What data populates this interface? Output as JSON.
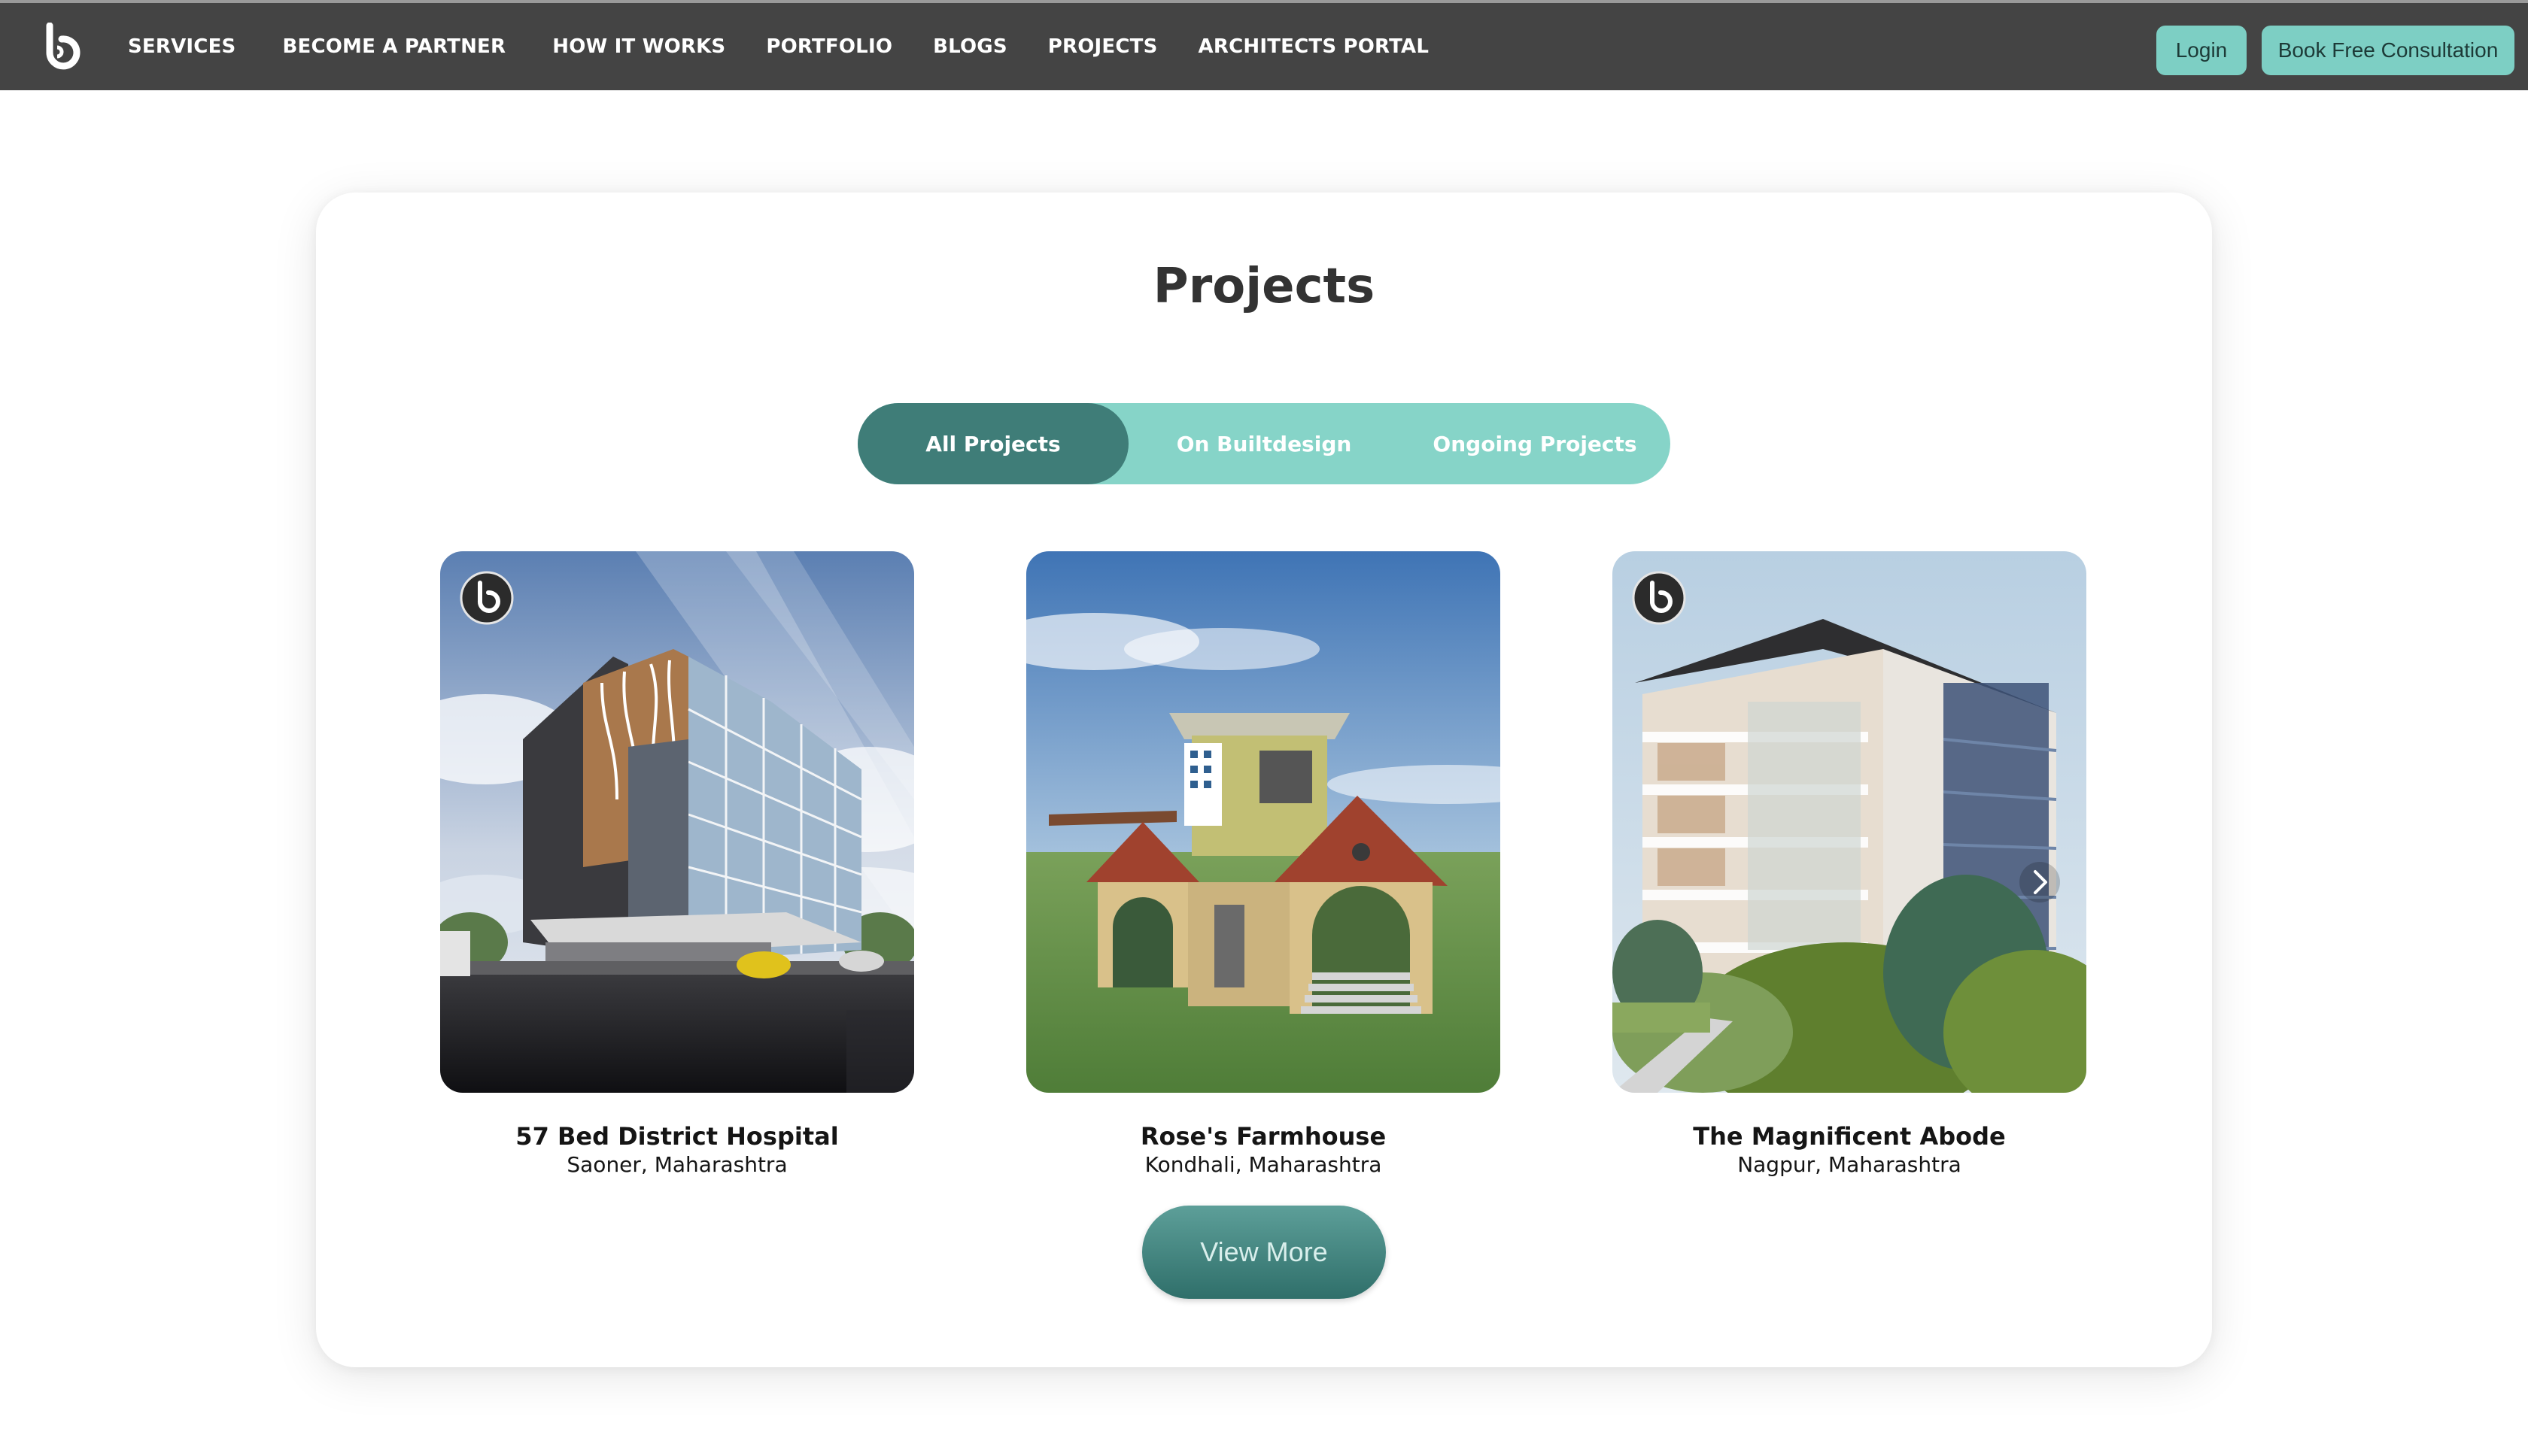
{
  "nav": {
    "logo_icon": "builtdesign-b-logo",
    "links": [
      "SERVICES",
      "BECOME A PARTNER",
      "HOW IT WORKS",
      "PORTFOLIO",
      "BLOGS",
      "PROJECTS",
      "ARCHITECTS PORTAL"
    ],
    "login_label": "Login",
    "consultation_label": "Book Free Consultation",
    "accent_color": "#7dcfc4",
    "bar_color": "#444444"
  },
  "section": {
    "title": "Projects",
    "tabs": [
      "All Projects",
      "On Builtdesign",
      "Ongoing Projects"
    ],
    "active_tab": "All Projects",
    "active_tab_color": "#3f7d78",
    "tab_bar_color": "#86d4c8"
  },
  "projects": [
    {
      "name": "57 Bed District Hospital",
      "location": "Saoner, Maharashtra",
      "watermark_icon": "builtdesign-watermark-icon"
    },
    {
      "name": "Rose's Farmhouse",
      "location": "Kondhali, Maharashtra"
    },
    {
      "name": "The Magnificent Abode",
      "location": "Nagpur, Maharashtra",
      "watermark_icon": "builtdesign-watermark-icon",
      "nav_icon": "chevron-right-icon"
    }
  ],
  "view_more_label": "View More"
}
